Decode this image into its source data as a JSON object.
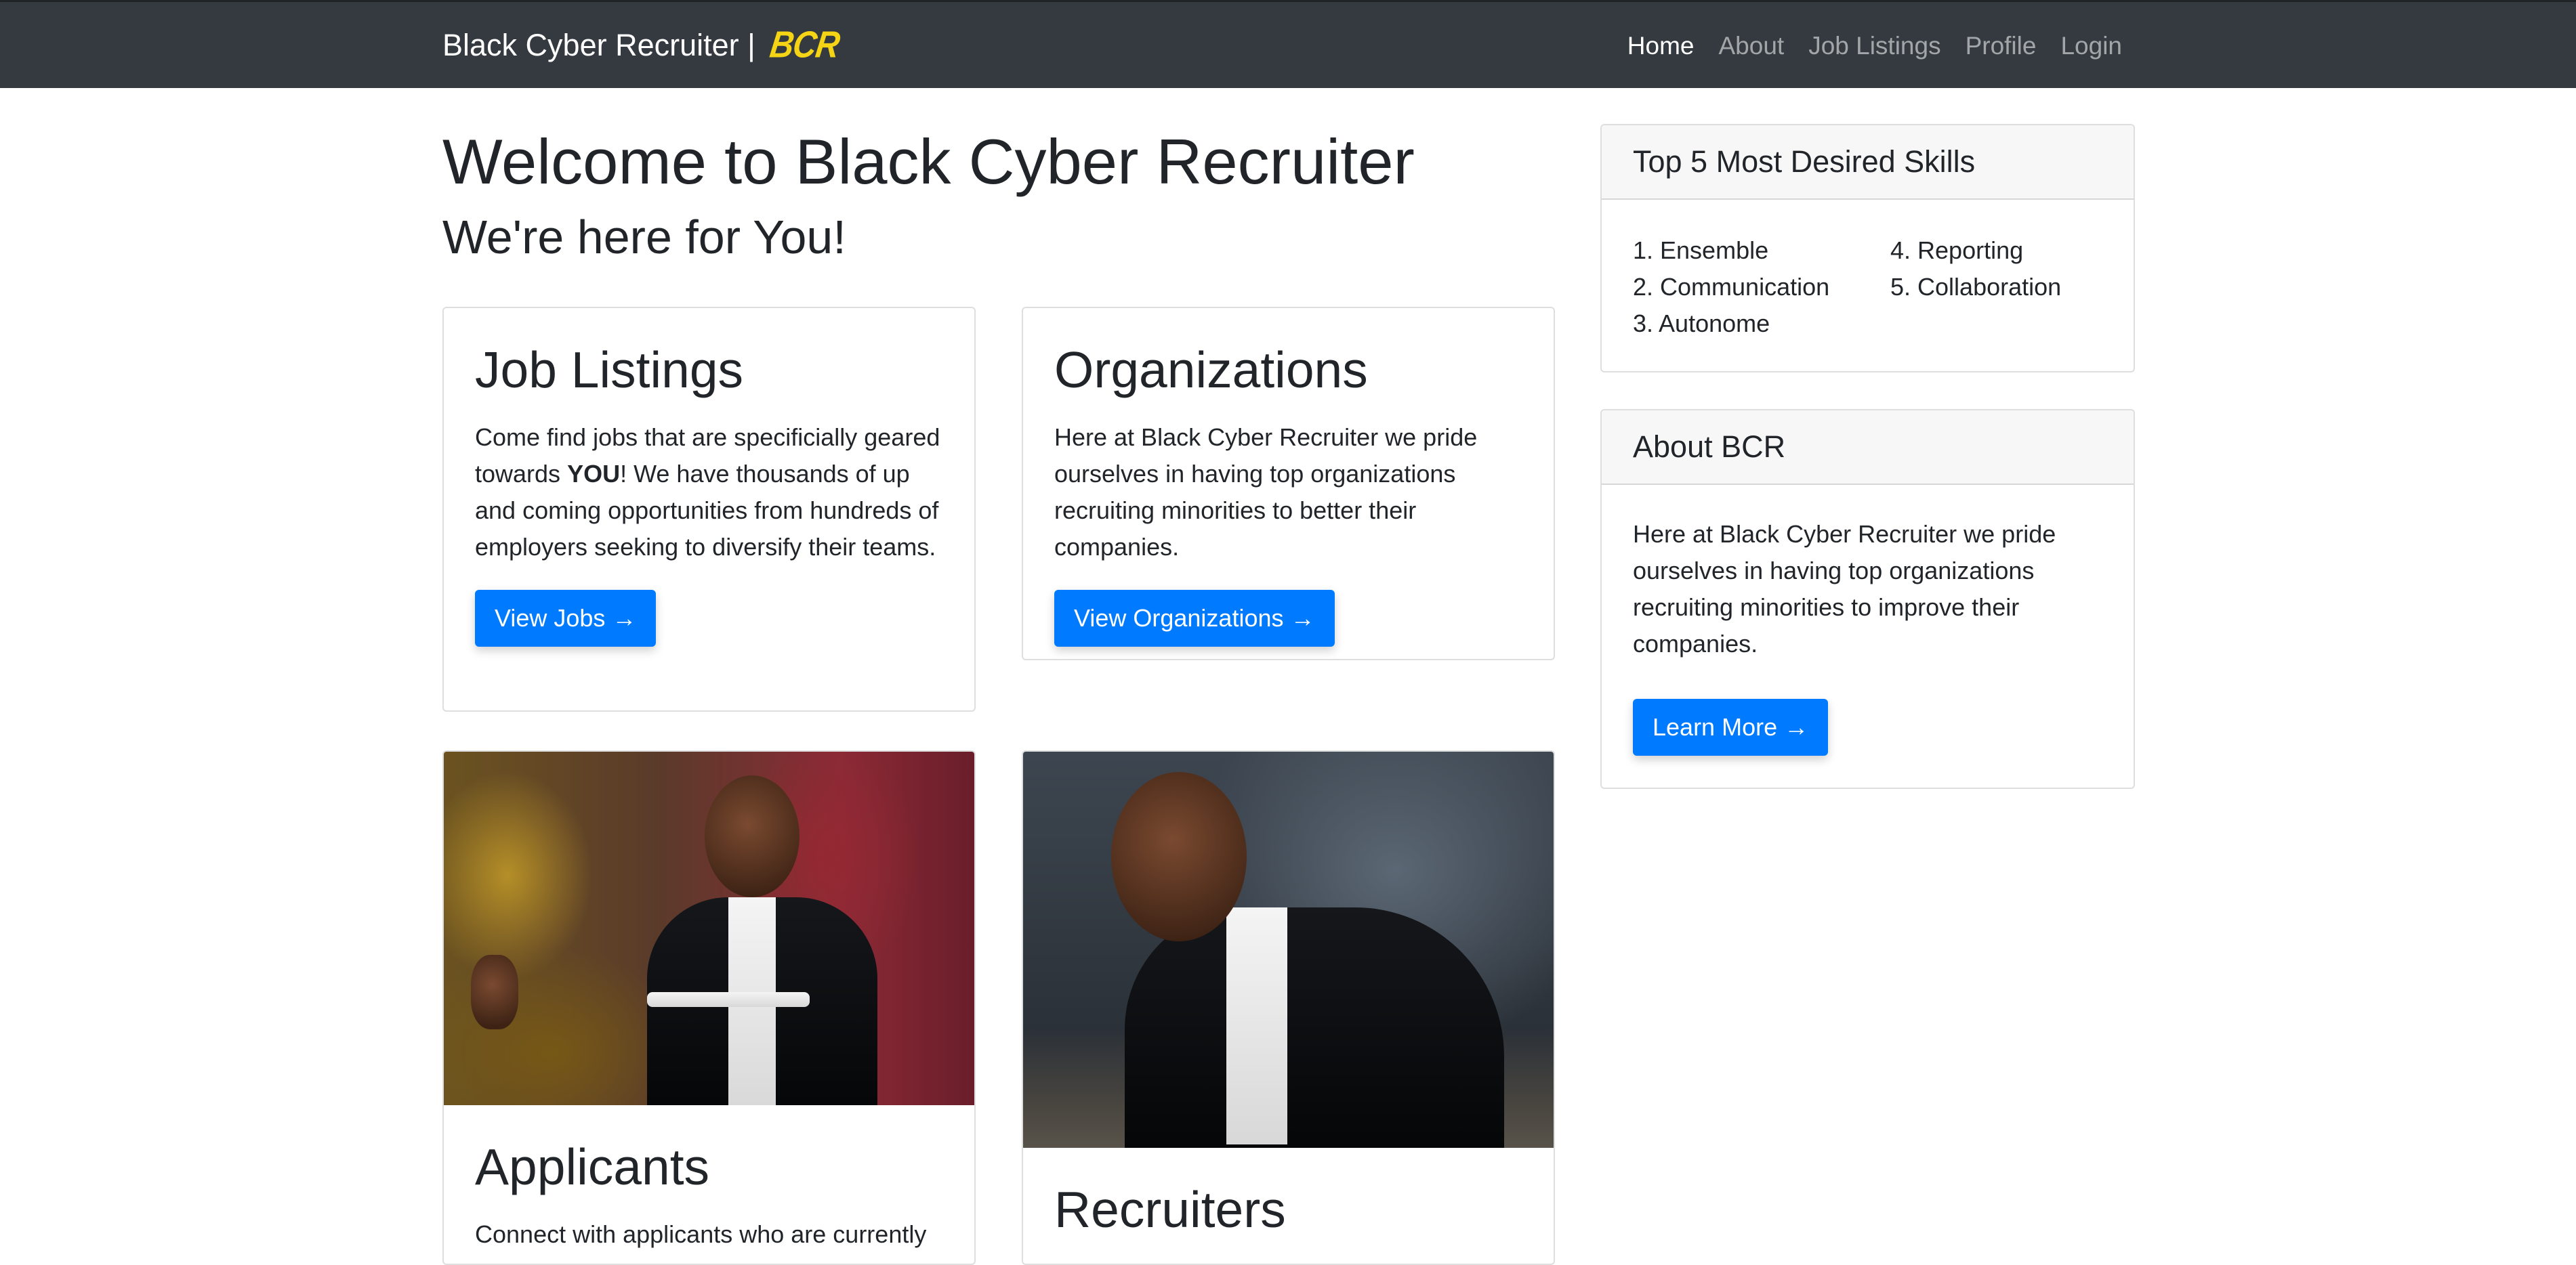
{
  "navbar": {
    "brand": "Black Cyber Recruiter |",
    "brand_logo": "BCR",
    "links": [
      "Home",
      "About",
      "Job Listings",
      "Profile",
      "Login"
    ]
  },
  "hero": {
    "title": "Welcome to Black Cyber Recruiter",
    "subtitle": "We're here for You!"
  },
  "cards": {
    "jobs": {
      "title": "Job Listings",
      "text_before": "Come find jobs that are specificially geared towards ",
      "text_bold": "YOU",
      "text_after": "! We have thousands of up and coming opportunities from hundreds of employers seeking to diversify their teams.",
      "button": "View Jobs →"
    },
    "orgs": {
      "title": "Organizations",
      "text": "Here at Black Cyber Recruiter we pride ourselves in having top organizations recruiting minorities to better their companies.",
      "button": "View Organizations →"
    },
    "applicants": {
      "title": "Applicants",
      "text": "Connect with applicants who are currently"
    },
    "recruiters": {
      "title": "Recruiters"
    }
  },
  "sidebar": {
    "skills": {
      "title": "Top 5 Most Desired Skills",
      "items": [
        "1. Ensemble",
        "2. Communication",
        "3. Autonome",
        "4. Reporting",
        "5. Collaboration"
      ]
    },
    "about": {
      "title": "About BCR",
      "text": "Here at Black Cyber Recruiter we pride ourselves in having top organizations recruiting minorities to improve their companies.",
      "button": "Learn More →"
    }
  },
  "colors": {
    "navbar_bg": "#343a40",
    "primary": "#007bff",
    "logo": "#f5d416"
  }
}
